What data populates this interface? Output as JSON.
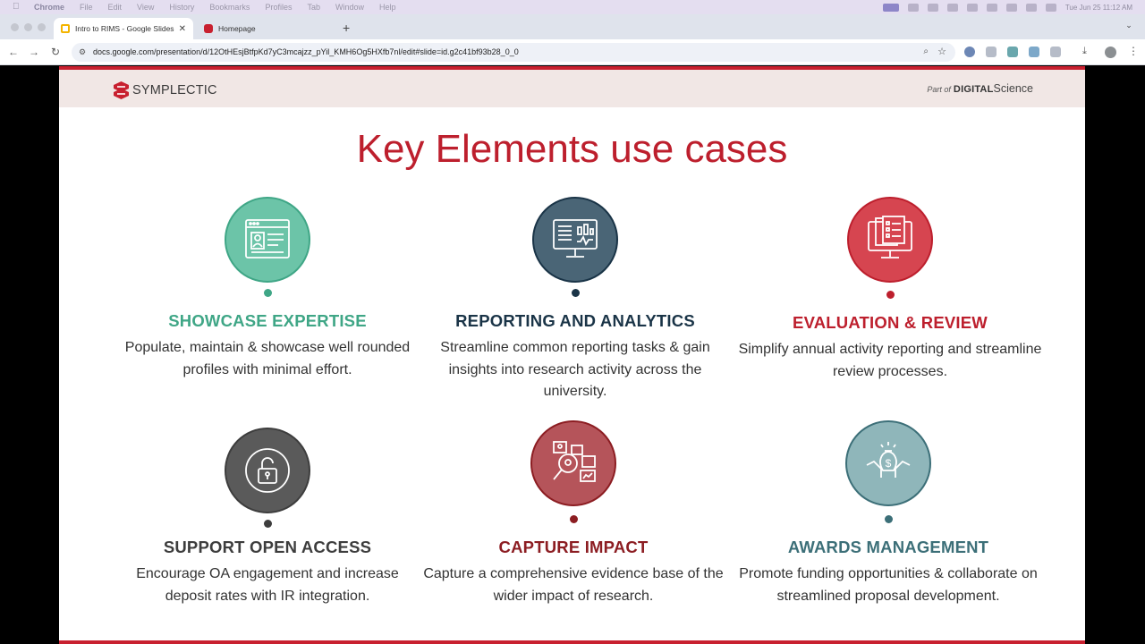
{
  "menubar": {
    "items": [
      "Chrome",
      "File",
      "Edit",
      "View",
      "History",
      "Bookmarks",
      "Profiles",
      "Tab",
      "Window",
      "Help"
    ],
    "clock": "Tue Jun 25  11:12 AM"
  },
  "tabs": [
    {
      "title": "Intro to RIMS - Google Slides",
      "favicon": "google-slides-icon"
    },
    {
      "title": "Homepage",
      "favicon": "symplectic-icon"
    }
  ],
  "address_bar": {
    "url": "docs.google.com/presentation/d/12OtHEsjBtfpKd7yC3mcajzz_pYil_KMH6Og5HXfb7nl/edit#slide=id.g2c41bf93b28_0_0"
  },
  "slide": {
    "brand": "SYMPLECTIC",
    "partner_prefix": "Part of",
    "partner_bold": "DIGITAL",
    "partner_light": "Science",
    "title": "Key Elements use cases",
    "colors": {
      "accent_red": "#bd1f2d",
      "teal": "#3fa686",
      "navy": "#1a3447",
      "gray": "#3d3d3d",
      "maroon": "#8c1d22",
      "slate": "#3c6f78"
    },
    "cards": [
      {
        "title": "SHOWCASE EXPERTISE",
        "desc": "Populate, maintain & showcase well rounded profiles with minimal effort.",
        "icon": "profile-page-icon"
      },
      {
        "title": "REPORTING AND ANALYTICS",
        "desc": "Streamline common reporting tasks & gain insights into research activity across the university.",
        "icon": "analytics-monitor-icon"
      },
      {
        "title": "EVALUATION & REVIEW",
        "desc": "Simplify annual activity reporting and streamline review processes.",
        "icon": "review-checklist-icon"
      },
      {
        "title": "SUPPORT OPEN ACCESS",
        "desc": "Encourage OA engagement and increase deposit rates with IR integration.",
        "icon": "open-lock-icon"
      },
      {
        "title": "CAPTURE IMPACT",
        "desc": "Capture a comprehensive evidence base of the wider impact of research.",
        "icon": "impact-search-icon"
      },
      {
        "title": "AWARDS MANAGEMENT",
        "desc": "Promote funding opportunities & collaborate on streamlined proposal development.",
        "icon": "funding-hands-icon"
      }
    ]
  }
}
